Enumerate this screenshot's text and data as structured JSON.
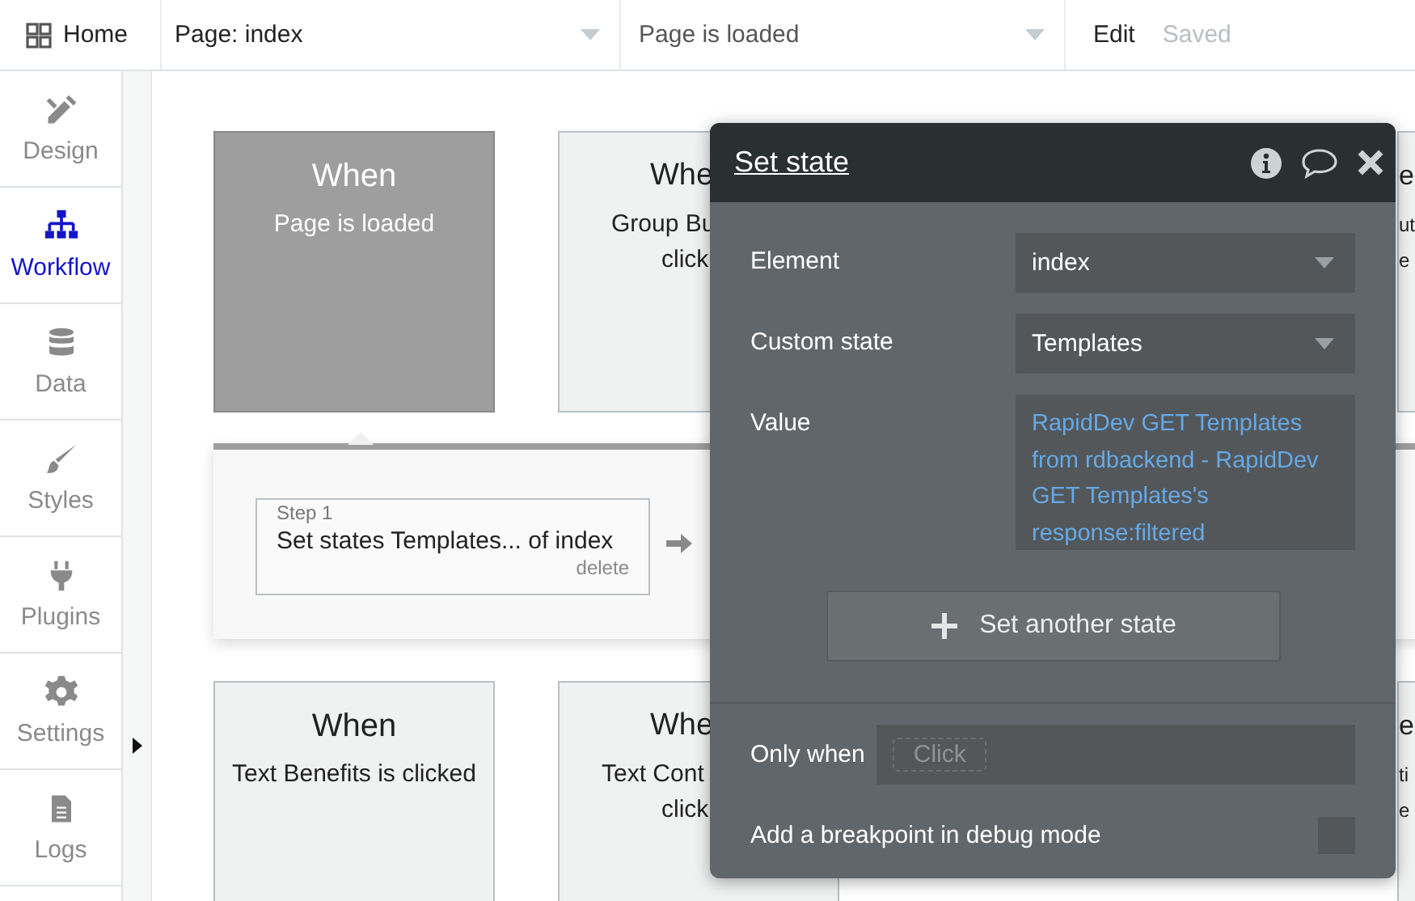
{
  "topbar": {
    "home": "Home",
    "page_select": "Page: index",
    "event_select": "Page is loaded",
    "edit": "Edit",
    "status": "Saved"
  },
  "sidebar": {
    "items": [
      {
        "label": "Design",
        "selected": false
      },
      {
        "label": "Workflow",
        "selected": true
      },
      {
        "label": "Data",
        "selected": false
      },
      {
        "label": "Styles",
        "selected": false
      },
      {
        "label": "Plugins",
        "selected": false
      },
      {
        "label": "Settings",
        "selected": false
      },
      {
        "label": "Logs",
        "selected": false
      }
    ]
  },
  "canvas": {
    "cards": [
      {
        "title": "When",
        "lines": [
          "Page is loaded"
        ],
        "selected": true
      },
      {
        "title": "Whe",
        "lines": [
          "Group Bu",
          "click"
        ],
        "selected": false
      },
      {
        "title": "e",
        "lines": [
          "ut",
          "e"
        ],
        "selected": false
      },
      {
        "title": "When",
        "lines": [
          "Text Benefits is clicked"
        ],
        "selected": false
      },
      {
        "title": "Whe",
        "lines": [
          "Text Cont",
          "click"
        ],
        "selected": false
      },
      {
        "title": "e",
        "lines": [
          "ti",
          "e"
        ],
        "selected": false
      }
    ],
    "workflow": {
      "step_label": "Step 1",
      "action": "Set states Templates... of index",
      "delete": "delete"
    }
  },
  "modal": {
    "title": "Set state",
    "fields": [
      {
        "label": "Element",
        "value": "index",
        "kind": "dropdown"
      },
      {
        "label": "Custom state",
        "value": "Templates",
        "kind": "dropdown"
      },
      {
        "label": "Value",
        "value": "RapidDev GET Templates from rdbackend - RapidDev GET Templates's response:filtered",
        "kind": "expression"
      }
    ],
    "add_button": "Set another state",
    "only_when": {
      "label": "Only when",
      "placeholder": "Click"
    },
    "breakpoint": {
      "label": "Add a breakpoint in debug mode",
      "checked": false
    }
  }
}
